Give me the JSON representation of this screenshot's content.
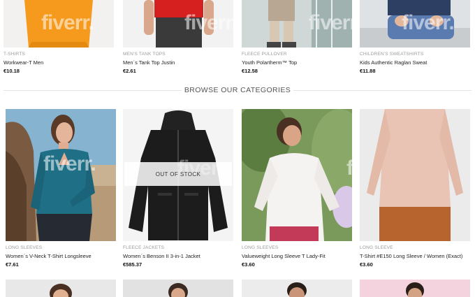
{
  "top_products": [
    {
      "category": "T-SHIRTS",
      "name": "Workwear-T Men",
      "price": "€10.18",
      "img_color": "#f59a1c"
    },
    {
      "category": "MEN'S TANK TOPS",
      "name": "Men´s Tank Top Justin",
      "price": "€2.61",
      "img_color": "#d62020"
    },
    {
      "category": "FLEECE PULLOVER",
      "name": "Youth Polartherm™ Top",
      "price": "€12.58",
      "img_color": "#bfc9c4"
    },
    {
      "category": "CHILDREN'S SWEATSHIRTS",
      "name": "Kids Authentic Raglan Sweat",
      "price": "€11.88",
      "img_color": "#3a5a8a"
    }
  ],
  "section": {
    "title": "BROWSE OUR CATEGORIES"
  },
  "products": [
    {
      "category": "LONG SLEEVES",
      "name": "Women´s V-Neck T-Shirt Longsleeve",
      "price": "€7.61",
      "img_color": "#1f6f86"
    },
    {
      "category": "FLEECE JACKETS",
      "name": "Women´s Benson II 3-in-1 Jacket",
      "price": "€585.37",
      "img_color": "#1c1c1c",
      "badge": "OUT OF STOCK"
    },
    {
      "category": "LONG SLEEVES",
      "name": "Valueweight Long Sleeve T Lady-Fit",
      "price": "€3.60",
      "img_color": "#f4f1ee"
    },
    {
      "category": "LONG SLEEVE",
      "name": "T-Shirt #E150 Long Sleeve / Women (Exact)",
      "price": "€3.60",
      "img_color": "#e9c3b3"
    }
  ],
  "watermark": "fiverr."
}
